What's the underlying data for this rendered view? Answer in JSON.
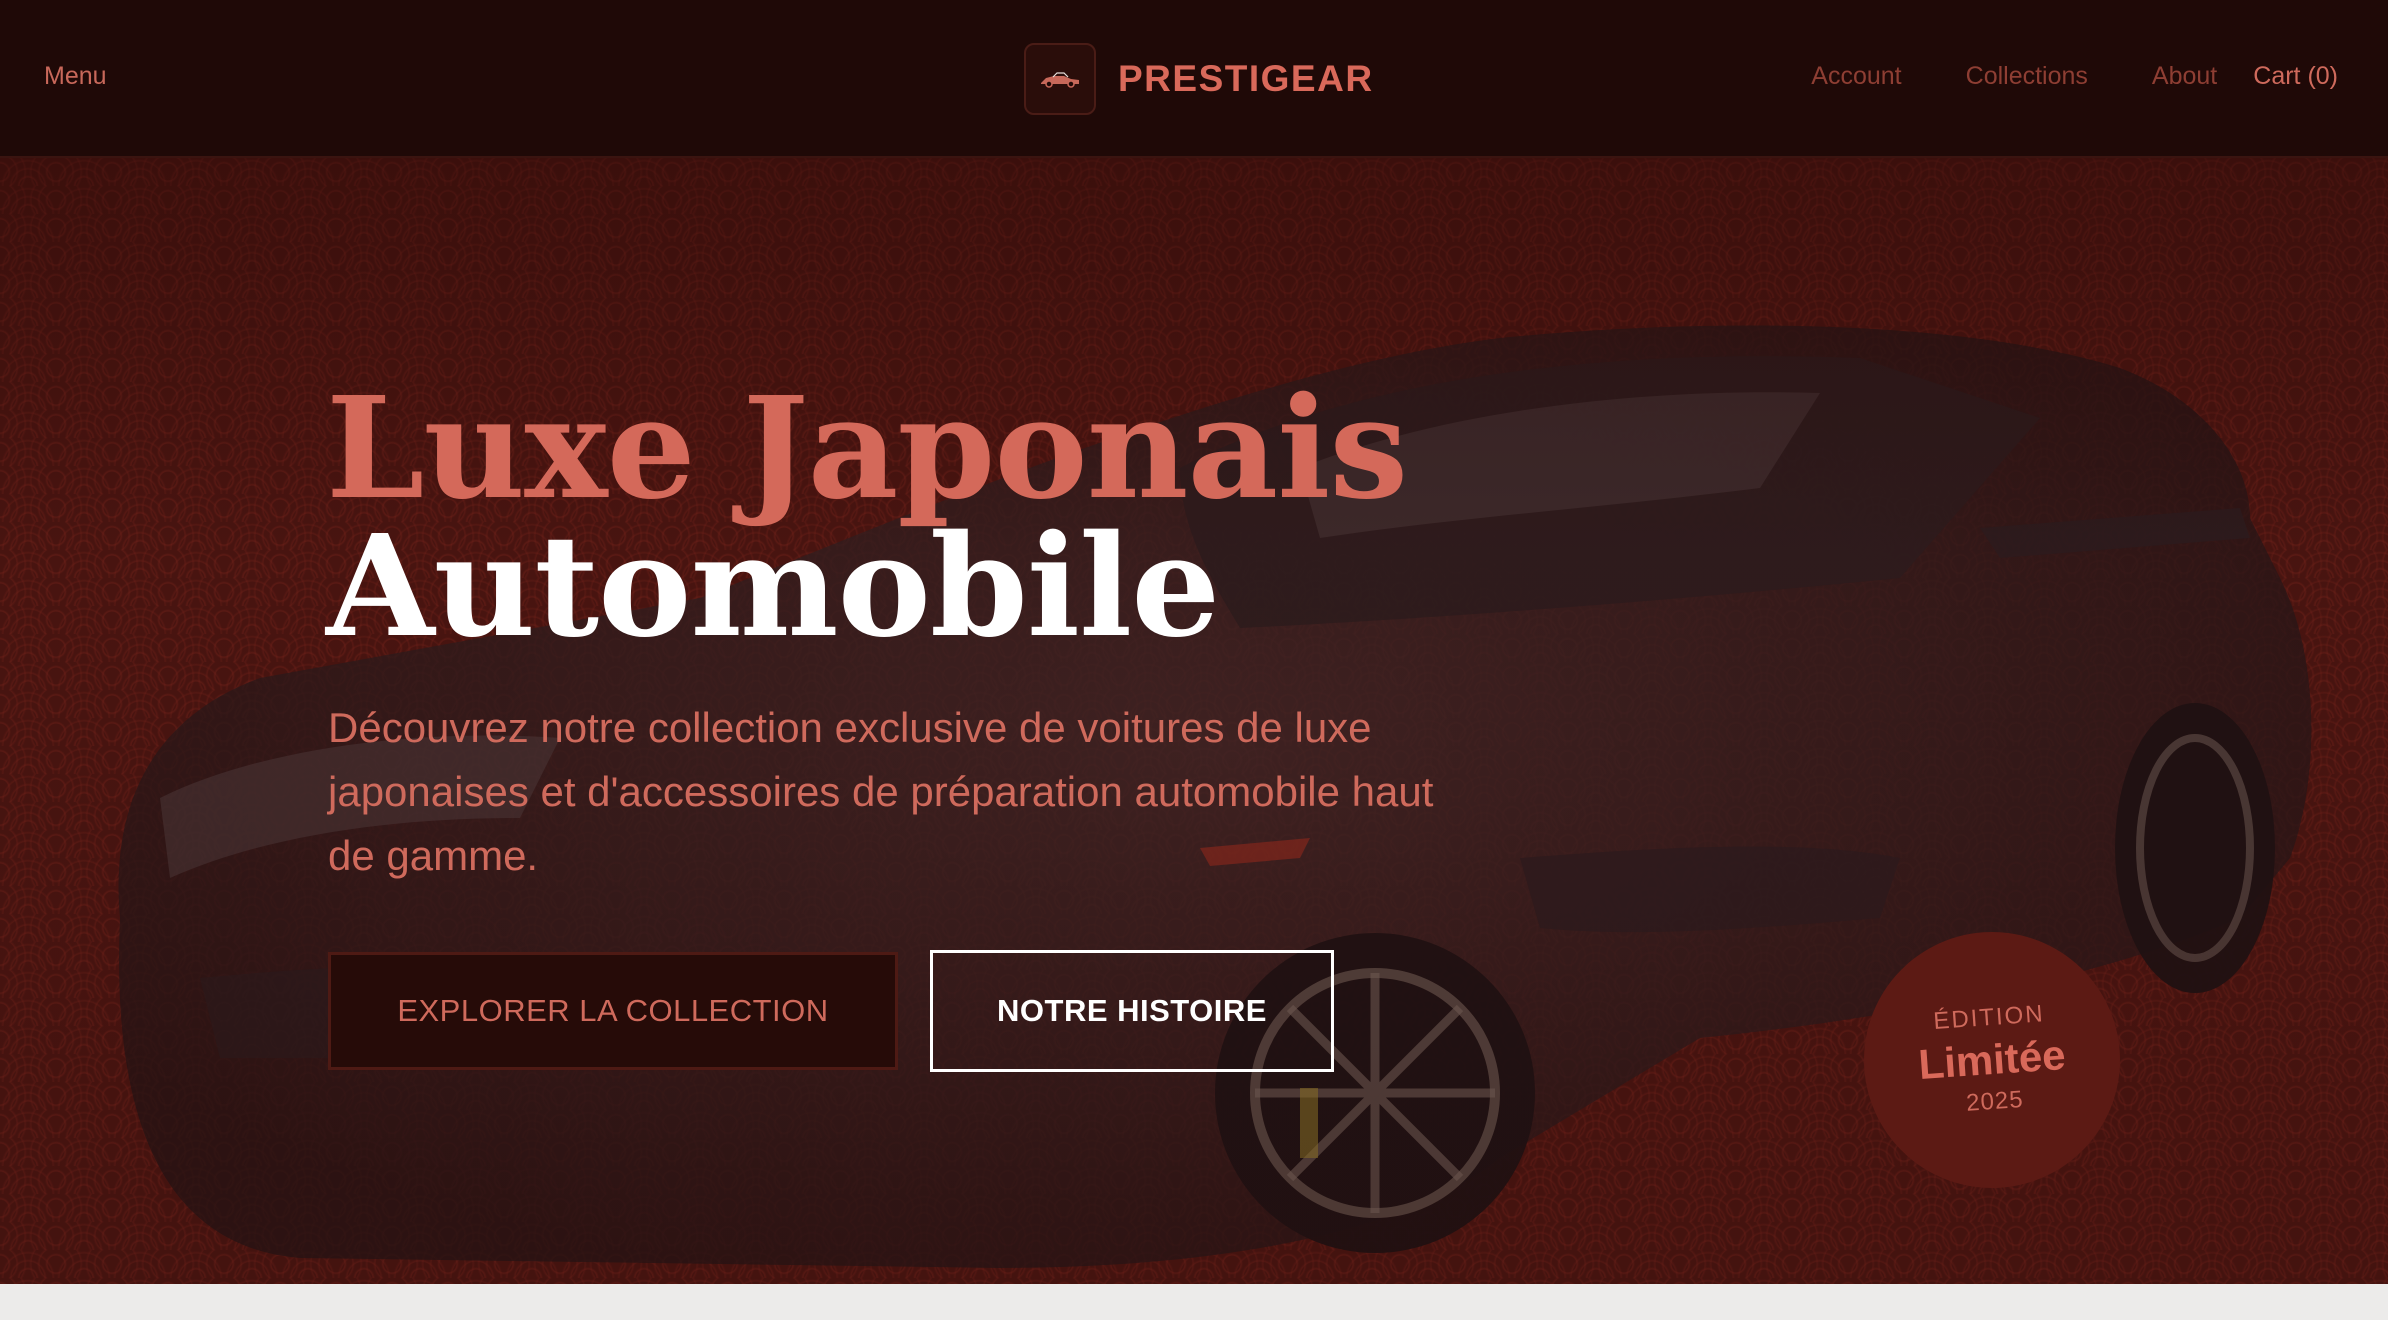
{
  "header": {
    "menu_label": "Menu",
    "brand_name": "PRESTIGEAR",
    "nav": {
      "account": "Account",
      "collections": "Collections",
      "about": "About",
      "cart": "Cart (0)"
    }
  },
  "hero": {
    "title_line1": "Luxe Japonais",
    "title_line2": "Automobile",
    "description": "Découvrez notre collection exclusive de voitures de luxe japonaises et d'accessoires de préparation automobile haut de gamme.",
    "primary_button": "EXPLORER LA COLLECTION",
    "secondary_button": "NOTRE HISTOIRE"
  },
  "badge": {
    "top": "ÉDITION",
    "middle": "Limitée",
    "bottom": "2025"
  },
  "colors": {
    "header_bg": "#1f0907",
    "accent": "#d4695a",
    "hero_bg": "#4a1511",
    "white": "#ffffff"
  },
  "icons": [
    "car-logo-icon"
  ]
}
